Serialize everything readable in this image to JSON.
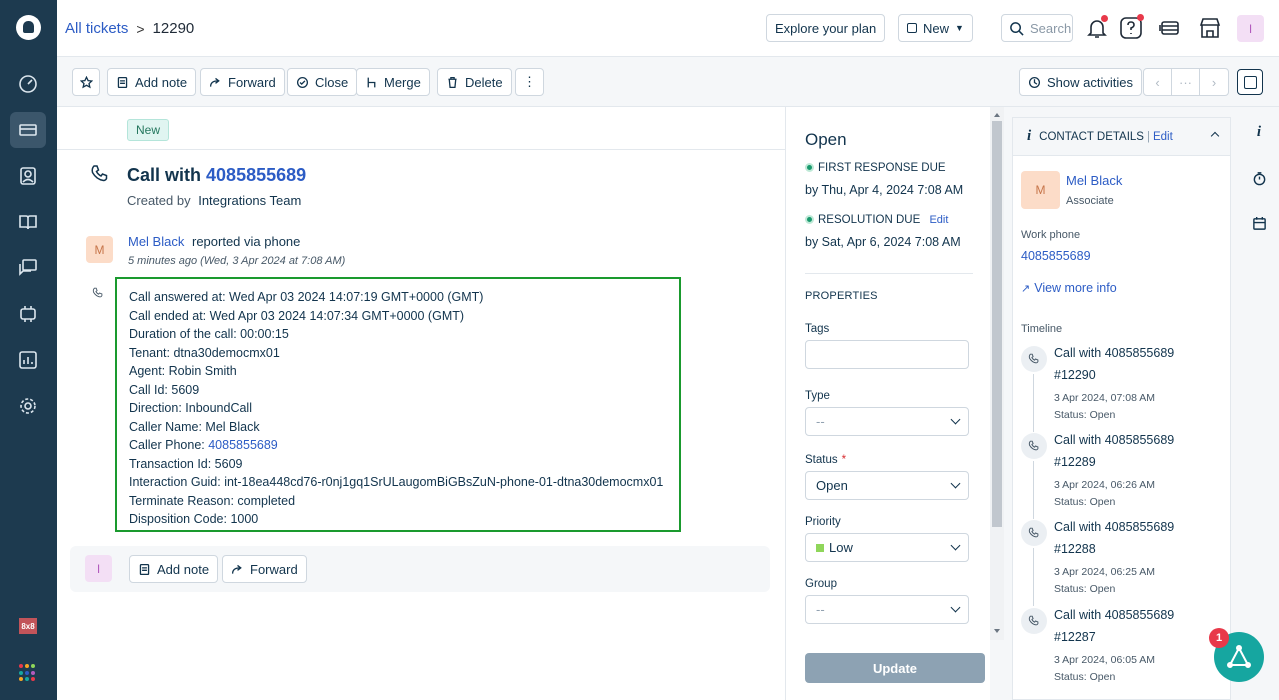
{
  "header": {
    "breadcrumb_root": "All tickets",
    "breadcrumb_sep": ">",
    "ticket_id": "12290",
    "explore_label": "Explore your plan",
    "new_label": "New",
    "search_placeholder": "Search",
    "user_initial": "I"
  },
  "toolbar": {
    "add_note": "Add note",
    "forward": "Forward",
    "close": "Close",
    "merge": "Merge",
    "delete": "Delete",
    "more": "⋮",
    "show_activities": "Show activities",
    "pager_prev": "‹",
    "pager_mid": "···",
    "pager_next": "›"
  },
  "ticket": {
    "status_badge": "New",
    "subject_prefix": "Call with",
    "subject_number": "4085855689",
    "created_by_label": "Created by",
    "created_by": "Integrations Team",
    "reporter_initial": "M",
    "reporter": "Mel Black",
    "reported_via": "reported via phone",
    "time_ago": "5 minutes ago (Wed, 3 Apr 2024 at 7:08 AM)",
    "call_details": [
      "Call answered at: Wed Apr 03 2024 14:07:19 GMT+0000 (GMT)",
      "Call ended at: Wed Apr 03 2024 14:07:34 GMT+0000 (GMT)",
      "Duration of the call: 00:00:15",
      "Tenant: dtna30democmx01",
      "Agent: Robin Smith",
      "Call Id: 5609",
      "Direction: InboundCall",
      "Caller Name: Mel Black"
    ],
    "caller_phone_label": "Caller Phone:",
    "caller_phone": "4085855689",
    "call_details_2": [
      "Transaction Id: 5609",
      "Interaction Guid: int-18ea448cd76-r0nj1gq1SrULaugomBiGBsZuN-phone-01-dtna30democmx01",
      "Terminate Reason: completed",
      "Disposition Code: 1000"
    ],
    "reply_initial": "I",
    "reply_add_note": "Add note",
    "reply_forward": "Forward"
  },
  "properties": {
    "status_title": "Open",
    "first_response_label": "FIRST RESPONSE DUE",
    "first_response_value": "by Thu, Apr 4, 2024 7:08 AM",
    "resolution_label": "RESOLUTION DUE",
    "resolution_edit": "Edit",
    "resolution_value": "by Sat, Apr 6, 2024 7:08 AM",
    "heading": "PROPERTIES",
    "tags_label": "Tags",
    "type_label": "Type",
    "type_value": "--",
    "status_label": "Status",
    "required_mark": "*",
    "status_value": "Open",
    "priority_label": "Priority",
    "priority_value": "Low",
    "group_label": "Group",
    "group_value": "--",
    "update_label": "Update"
  },
  "contact": {
    "header_label": "CONTACT DETAILS",
    "header_sep": "|",
    "header_edit": "Edit",
    "initial": "M",
    "name": "Mel Black",
    "role": "Associate",
    "work_phone_label": "Work phone",
    "work_phone": "4085855689",
    "view_more": "View more info",
    "timeline_label": "Timeline",
    "timeline": [
      {
        "title": "Call with 4085855689",
        "id": "#12290",
        "date": "3 Apr 2024, 07:08 AM",
        "status": "Status: Open"
      },
      {
        "title": "Call with 4085855689",
        "id": "#12289",
        "date": "3 Apr 2024, 06:26 AM",
        "status": "Status: Open"
      },
      {
        "title": "Call with 4085855689",
        "id": "#12288",
        "date": "3 Apr 2024, 06:25 AM",
        "status": "Status: Open"
      },
      {
        "title": "Call with 4085855689",
        "id": "#12287",
        "date": "3 Apr 2024, 06:05 AM",
        "status": "Status: Open"
      }
    ]
  },
  "misc": {
    "brand_label": "8x8",
    "fab_badge": "1",
    "rail_info": "i"
  },
  "colors": {
    "nav_bg": "#1d3a4f",
    "link": "#2c5cc5",
    "highlight_border": "#1a9a2e",
    "fab": "#16a6a0"
  }
}
